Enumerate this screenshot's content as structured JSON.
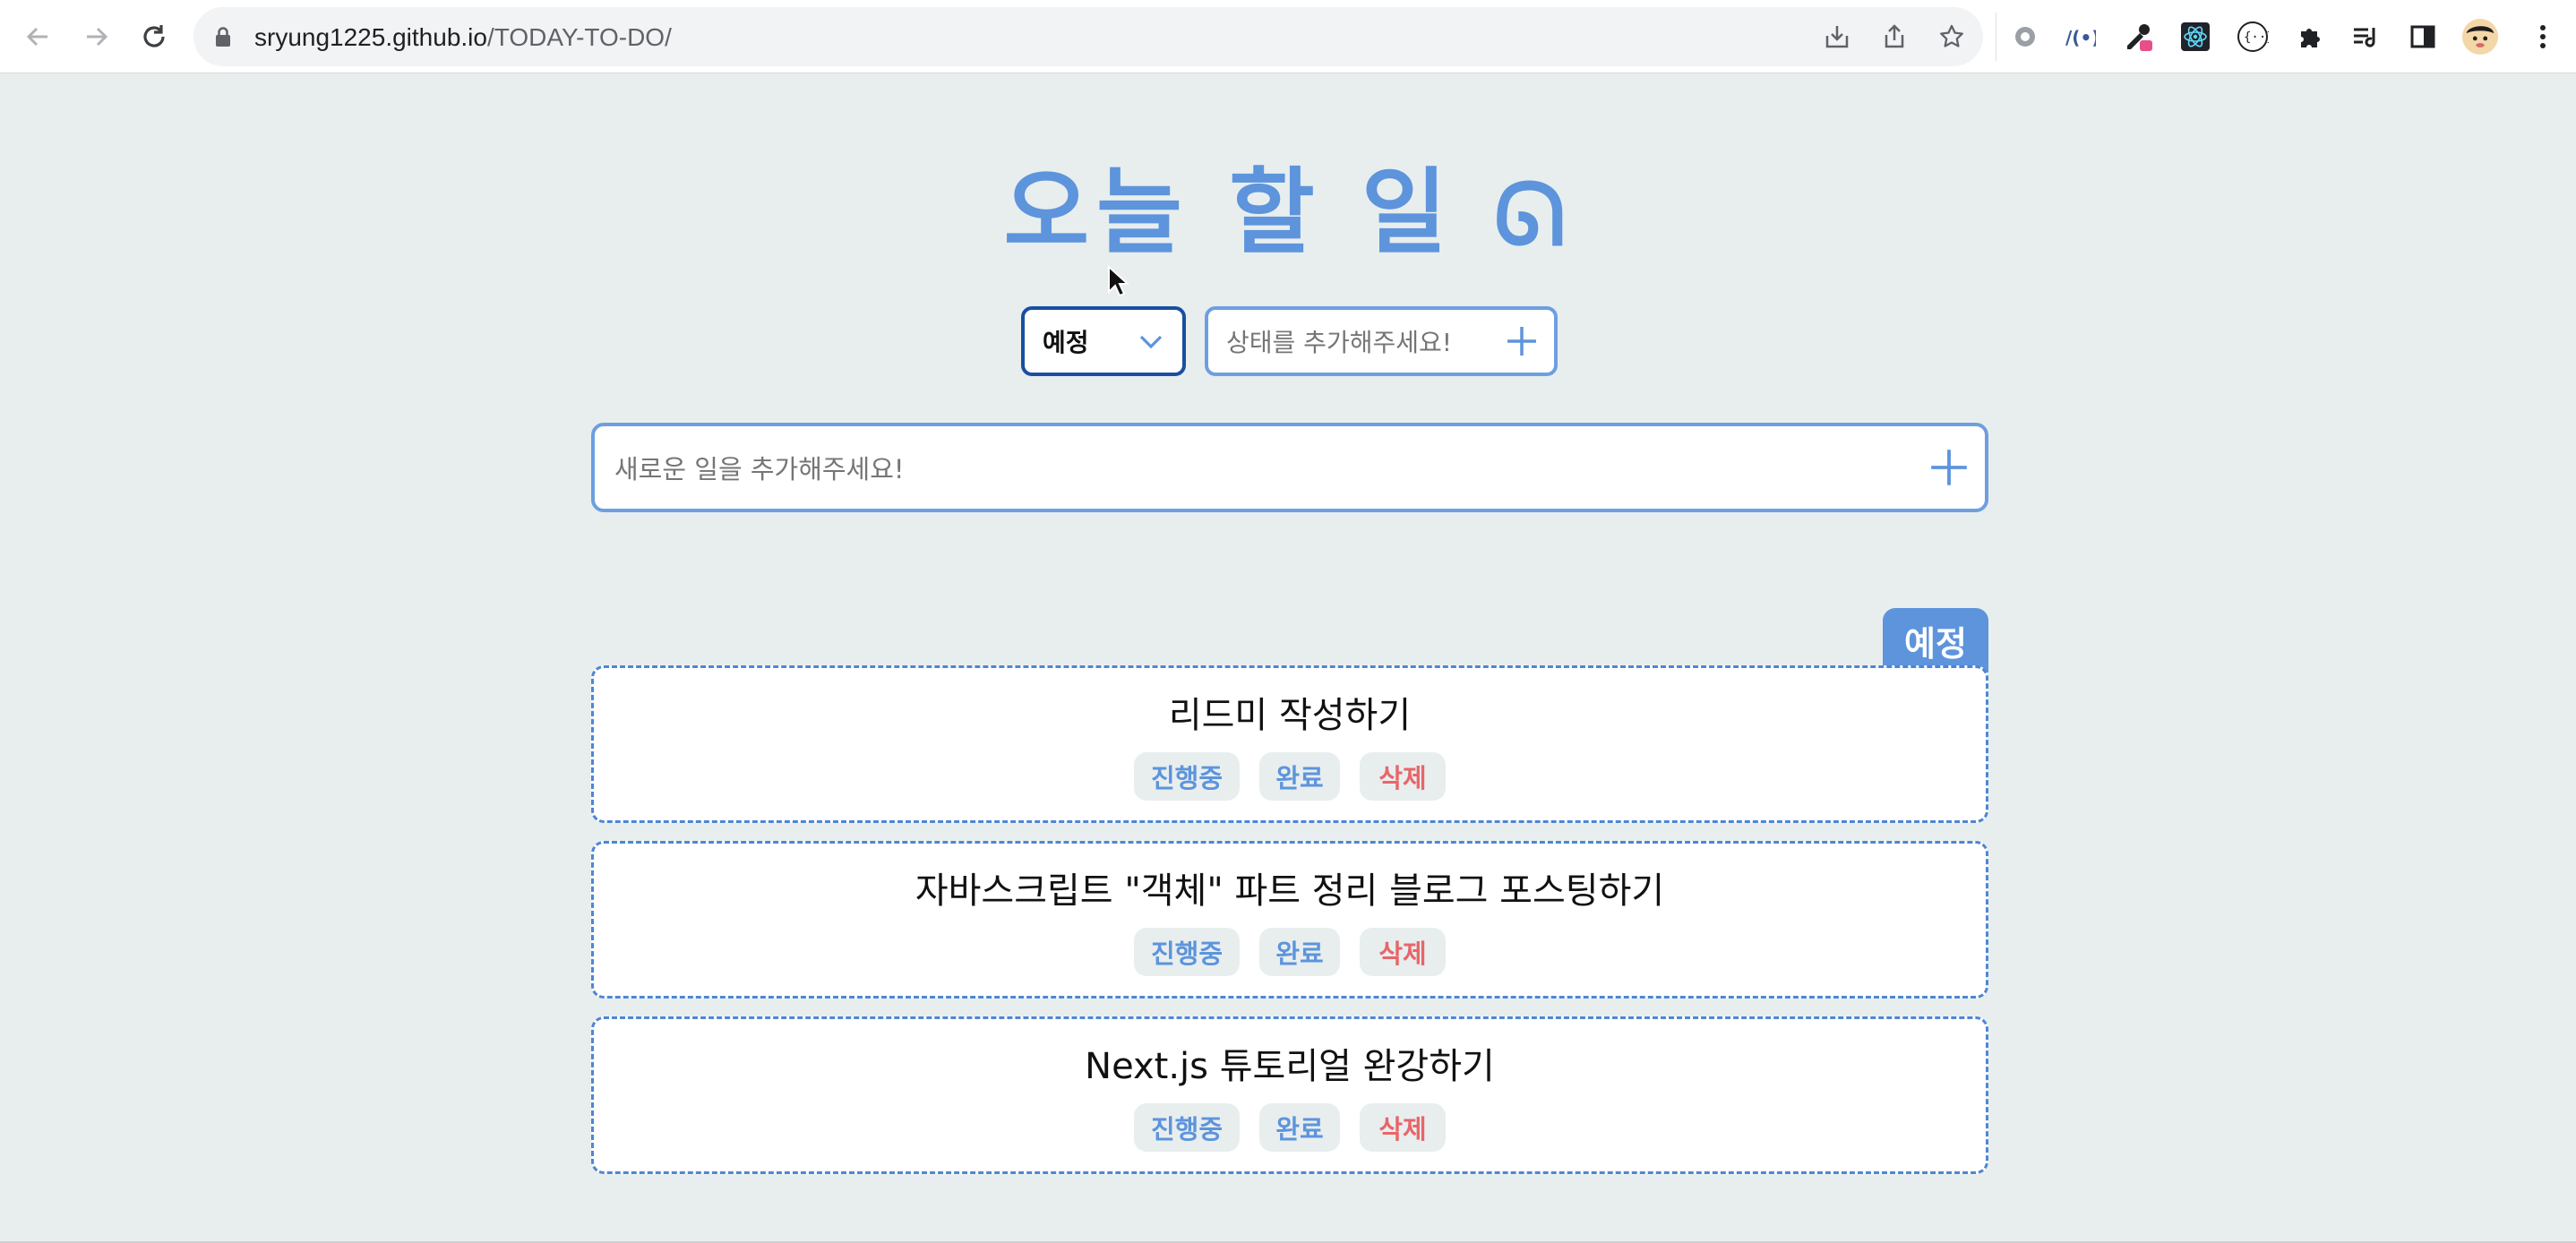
{
  "browser": {
    "url_host": "sryung1225.github.io",
    "url_path": "/TODAY-TO-DO/",
    "extensions": [
      "gear-extension-icon",
      "wave-extension-icon",
      "eyedropper-extension-icon",
      "react-devtools-icon",
      "code-extension-icon",
      "puzzle-extensions-icon",
      "reading-list-icon",
      "side-panel-icon",
      "profile-avatar",
      "more-menu-icon"
    ]
  },
  "app": {
    "title": "오늘 할 일",
    "title_emoji": "ᘏ",
    "status_select": {
      "value": "예정"
    },
    "status_input": {
      "placeholder": "상태를 추가해주세요!"
    },
    "new_task": {
      "placeholder": "새로운 일을 추가해주세요!"
    },
    "group": {
      "label": "예정",
      "tasks": [
        {
          "title": "리드미 작성하기",
          "actions": [
            "진행중",
            "완료",
            "삭제"
          ]
        },
        {
          "title": "자바스크립트 \"객체\" 파트 정리 블로그 포스팅하기",
          "actions": [
            "진행중",
            "완료",
            "삭제"
          ]
        },
        {
          "title": "Next.js 튜토리얼 완강하기",
          "actions": [
            "진행중",
            "완료",
            "삭제"
          ]
        }
      ]
    }
  },
  "colors": {
    "accent": "#5d94dc",
    "select_border": "#1a4fa0",
    "delete": "#e8656a",
    "background": "#e8eeee"
  }
}
